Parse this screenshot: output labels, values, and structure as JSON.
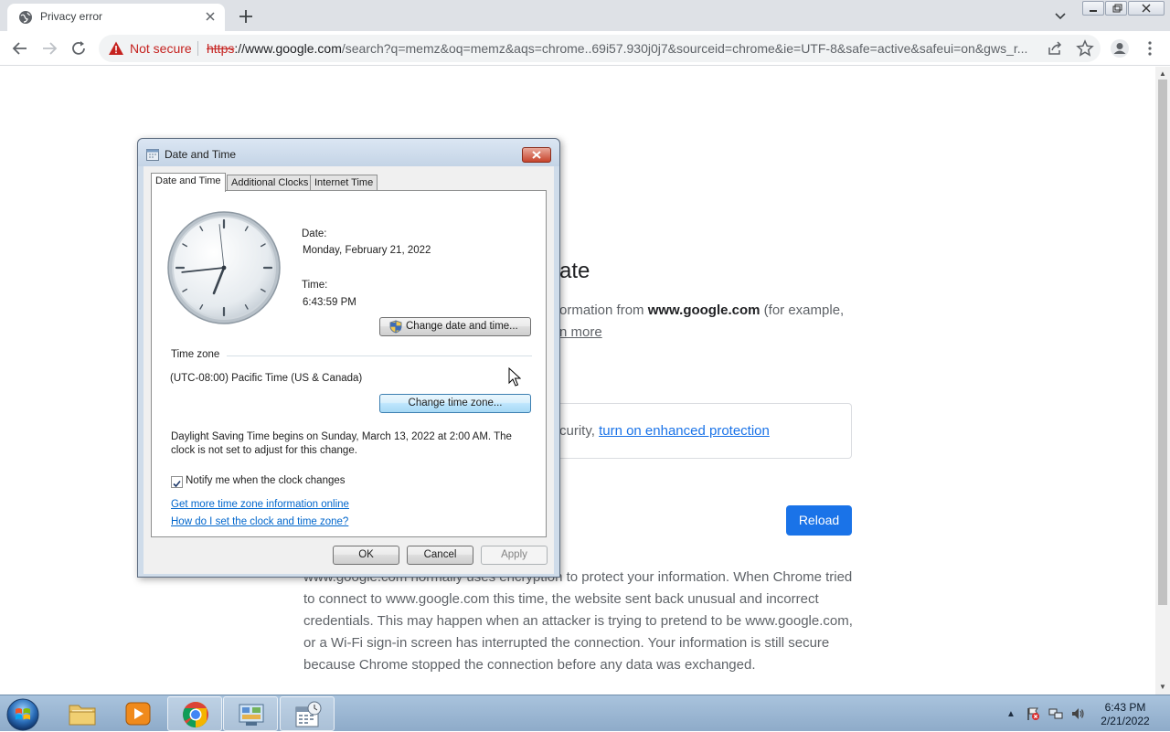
{
  "browser": {
    "tab_title": "Privacy error",
    "omnibox": {
      "security_label": "Not secure",
      "url_scheme": "https",
      "url_host": "://www.google.com",
      "url_rest": "/search?q=memz&oq=memz&aqs=chrome..69i57.930j0j7&sourceid=chrome&ie=UTF-8&safe=active&safeui=on&gws_r..."
    }
  },
  "page": {
    "heading_fragment": "ate",
    "para1_pre": "ormation from ",
    "para1_host": "www.google.com",
    "para1_post": " (for example,",
    "learn_more": "n more",
    "enhanced_pre": "curity, ",
    "enhanced_link": "turn on enhanced protection",
    "reload_label": "Reload",
    "details": "www.google.com normally uses encryption to protect your information. When Chrome tried to connect to www.google.com this time, the website sent back unusual and incorrect credentials. This may happen when an attacker is trying to pretend to be www.google.com, or a Wi-Fi sign-in screen has interrupted the connection. Your information is still secure because Chrome stopped the connection before any data was exchanged."
  },
  "dialog": {
    "title": "Date and Time",
    "tabs": [
      "Date and Time",
      "Additional Clocks",
      "Internet Time"
    ],
    "date_label": "Date:",
    "date_value": "Monday, February 21, 2022",
    "time_label": "Time:",
    "time_value": "6:43:59 PM",
    "change_datetime_button": "Change date and time...",
    "timezone_label": "Time zone",
    "timezone_value": "(UTC-08:00) Pacific Time (US & Canada)",
    "change_timezone_button": "Change time zone...",
    "dst_line1": "Daylight Saving Time begins on Sunday, March 13, 2022 at 2:00 AM. The",
    "dst_line2": "clock is not set to adjust for this change.",
    "notify_label": "Notify me when the clock changes",
    "notify_checked": true,
    "link_more_info": "Get more time zone information online",
    "link_howto": "How do I set the clock and time zone?",
    "ok_button": "OK",
    "cancel_button": "Cancel",
    "apply_button": "Apply",
    "clock_time": {
      "hour": 6,
      "minute": 43,
      "second": 59
    }
  },
  "taskbar": {
    "time": "6:43 PM",
    "date": "2/21/2022",
    "apps": [
      "start-orb",
      "explorer-icon",
      "media-player-icon",
      "chrome-icon",
      "control-panel-icon",
      "date-time-icon"
    ]
  },
  "colors": {
    "accent_blue": "#1a73e8",
    "not_secure_red": "#c5221f",
    "taskbar": "#9fb9d4",
    "win_link": "#0066cc"
  }
}
